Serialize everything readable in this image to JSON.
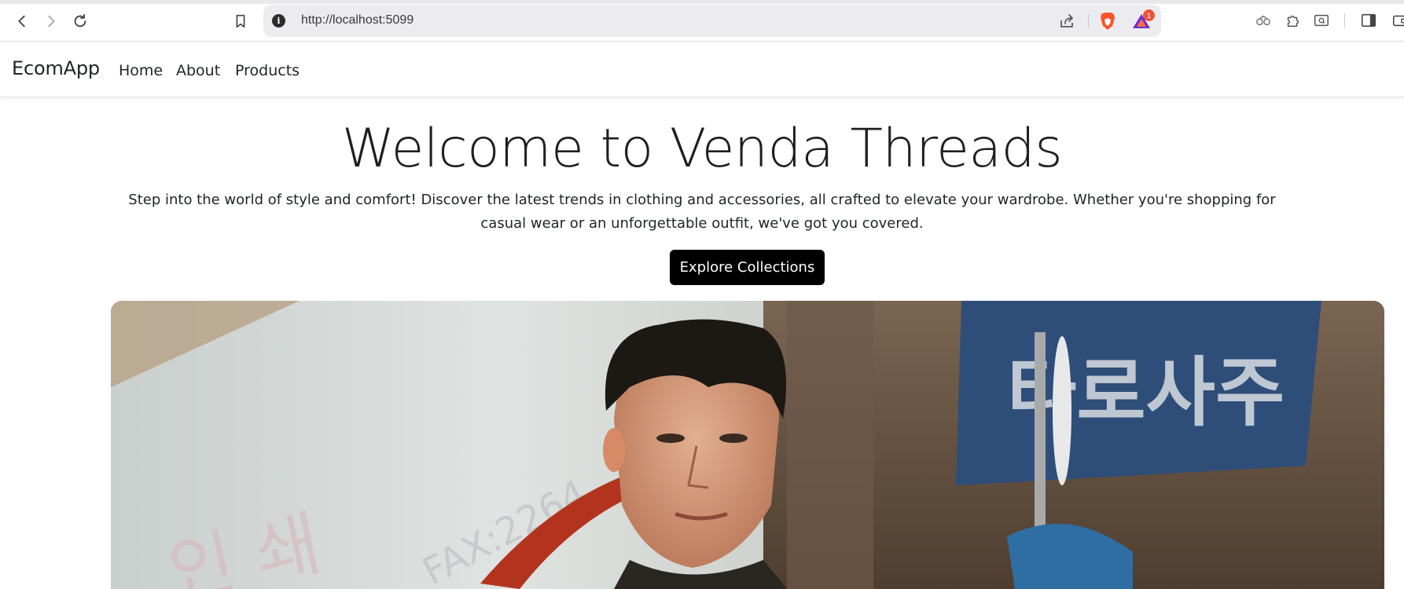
{
  "browser": {
    "url": "http://localhost:5099",
    "rewards_count": "1",
    "icons": {
      "back": "back-arrow-icon",
      "forward": "forward-arrow-icon",
      "reload": "reload-icon",
      "bookmark": "bookmark-icon",
      "site_info": "info-icon",
      "share": "share-icon",
      "brave_shields": "brave-lion-icon",
      "rewards": "brave-rewards-icon",
      "vpn": "vpn-icon",
      "extensions": "puzzle-icon",
      "tab_search": "tab-search-icon",
      "sidebar": "sidebar-icon",
      "wallet": "wallet-icon"
    }
  },
  "navbar": {
    "brand": "EcomApp",
    "links": [
      "Home",
      "About",
      "Products"
    ]
  },
  "hero": {
    "title": "Welcome to Venda Threads",
    "lead": "Step into the world of style and comfort! Discover the latest trends in clothing and accessories, all crafted to elevate your wardrobe. Whether you're shopping for casual wear or an unforgettable outfit, we've got you covered.",
    "cta_label": "Explore Collections",
    "image": {
      "subject": "man-street-fashion-photo",
      "sign_text": "타로사주",
      "background_text": "FAX:2264"
    }
  },
  "colors": {
    "cta_bg": "#000000",
    "cta_text": "#ffffff",
    "text": "#212529",
    "brave_orange": "#fb542b",
    "rewards_badge": "#f0533a"
  }
}
